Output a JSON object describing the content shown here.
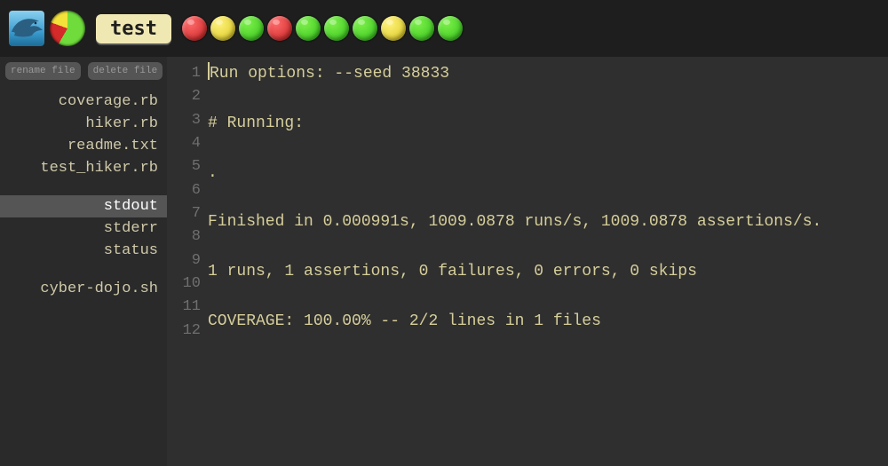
{
  "toolbar": {
    "test_label": "test",
    "lights": [
      "red",
      "amber",
      "green",
      "red",
      "green",
      "green",
      "green",
      "amber",
      "green",
      "green"
    ]
  },
  "sidebar": {
    "rename_label": "rename file",
    "delete_label": "delete file",
    "files": [
      {
        "name": "coverage.rb",
        "selected": false
      },
      {
        "name": "hiker.rb",
        "selected": false
      },
      {
        "name": "readme.txt",
        "selected": false
      },
      {
        "name": "test_hiker.rb",
        "selected": false
      }
    ],
    "outputs": [
      {
        "name": "stdout",
        "selected": true
      },
      {
        "name": "stderr",
        "selected": false
      },
      {
        "name": "status",
        "selected": false
      }
    ],
    "scripts": [
      {
        "name": "cyber-dojo.sh",
        "selected": false
      }
    ]
  },
  "editor": {
    "lines": [
      "Run options: --seed 38833",
      "",
      "# Running:",
      "",
      ".",
      "",
      "Finished in 0.000991s, 1009.0878 runs/s, 1009.0878 assertions/s.",
      "",
      "1 runs, 1 assertions, 0 failures, 0 errors, 0 skips",
      "",
      "COVERAGE: 100.00% -- 2/2 lines in 1 files",
      ""
    ]
  }
}
